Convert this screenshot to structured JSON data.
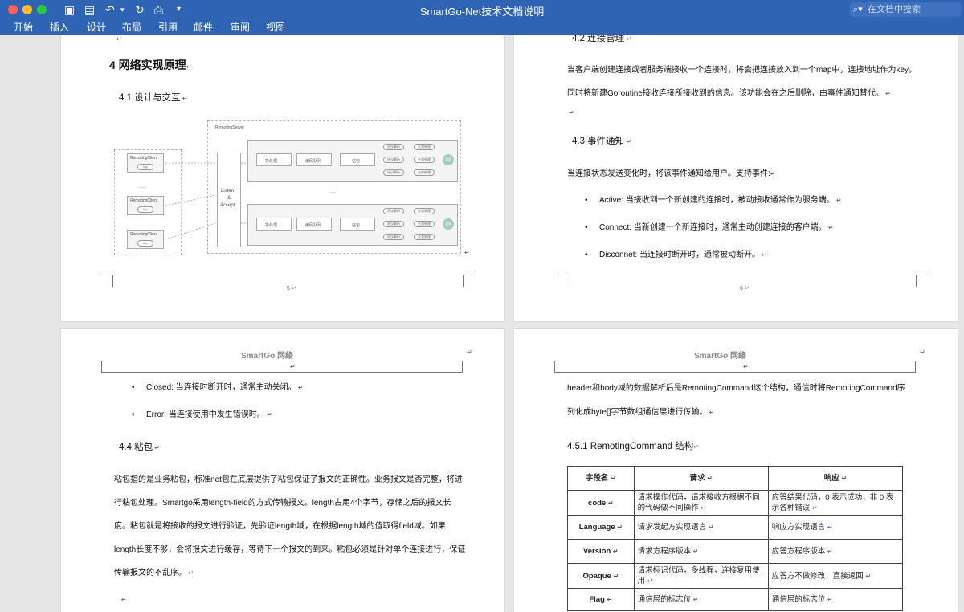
{
  "window": {
    "title": "SmartGo-Net技术文档说明",
    "search_placeholder": "在文档中搜索"
  },
  "ribbon": {
    "tabs": [
      "开始",
      "插入",
      "设计",
      "布局",
      "引用",
      "邮件",
      "审阅",
      "视图"
    ]
  },
  "page5": {
    "h1": "4   网络实现原理",
    "h2_1": "4.1   设计与交互",
    "page_number": "5",
    "diagram": {
      "server_label": "RemotingServer",
      "client_label": "RemotingClient",
      "client_sub": "tcp",
      "ellipsis": "......",
      "listen_lines": [
        "Listen",
        "&",
        "Accept"
      ],
      "stage_labels": [
        "协处理",
        "编码队列",
        "粘包"
      ],
      "pills": [
        "协议解析",
        "业务处理"
      ],
      "circle_label": "回调"
    }
  },
  "page6": {
    "h2_2": "4.2   连接管理",
    "para1": "当客户端创建连接或者服务端接收一个连接时，将会把连接放入到一个map中，连接地址作为key。",
    "para2": "同时将新建Goroutine接收连接所接收到的信息。该功能会在之后删除，由事件通知替代。",
    "h2_3": "4.3   事件通知",
    "para3": "当连接状态发送变化时，将该事件通知给用户。支持事件:",
    "bullets": [
      "Active:  当接收到一个新创建的连接时，被动接收通常作为服务端。",
      "Connect:  当新创建一个新连接时，通常主动创建连接的客户端。",
      "Disconnet:  当连接时断开时，通常被动断开。"
    ],
    "page_number": "6"
  },
  "page7": {
    "header": "SmartGo  网络",
    "bullets": [
      "Closed:  当连接时断开时，通常主动关闭。",
      "Error:  当连接使用中发生错误时。"
    ],
    "h2_4": "4.4   粘包",
    "lines": [
      "粘包指的是业务粘包，标准net包在底层提供了粘包保证了报文的正确性。业务报文是否完整，将进",
      "行粘包处理。Smartgo采用length-field的方式传输报文。length占用4个字节，存储之后的报文长",
      "度。粘包就是将接收的报文进行验证，先验证length域，在根据length域的值取得field域。如果",
      "length长度不够，会将报文进行缓存，等待下一个报文的到来。粘包必须是针对单个连接进行，保证",
      "传输报文的不乱序。"
    ]
  },
  "page8": {
    "header": "SmartGo  网络",
    "line1": "header和body域的数据解析后是RemotingCommand这个结构，通信时将RemotingCommand序",
    "line2": "列化成byte[]字节数组通信层进行传输。",
    "h3": "4.5.1   RemotingCommand 结构",
    "table": {
      "headers": [
        "字段名",
        "请求",
        "响应"
      ],
      "rows": [
        [
          "code",
          "请求操作代码，请求接收方根据不同的代码做不同操作",
          "应答结果代码，0 表示成功，非 0 表示各种错误"
        ],
        [
          "Language",
          "请求发起方实现语言",
          "响应方实现语言"
        ],
        [
          "Version",
          "请求方程序版本",
          "应答方程序版本"
        ],
        [
          "Opaque",
          "请求标识代码，多线程，连接复用使用",
          "应答方不做修改，直接返回"
        ],
        [
          "Flag",
          "通信层的标志位",
          "通信层的标志位"
        ]
      ]
    }
  }
}
